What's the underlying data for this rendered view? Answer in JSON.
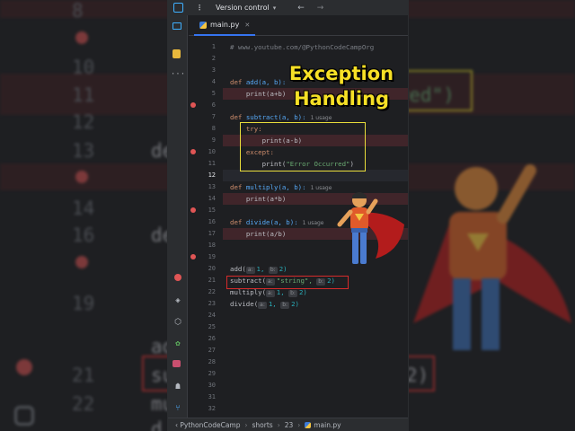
{
  "toolbar": {
    "version_control_label": "Version control"
  },
  "editor_tab": {
    "label": "main.py"
  },
  "overlay_title": {
    "line1": "Exception",
    "line2": "Handling"
  },
  "statusbar": {
    "project": "PythonCodeCamp",
    "folder": "shorts",
    "line": "23",
    "file": "main.py"
  },
  "line_numbers": [
    "1",
    "2",
    "3",
    "4",
    "5",
    "6",
    "7",
    "8",
    "9",
    "10",
    "11",
    "12",
    "13",
    "14",
    "15",
    "16",
    "17",
    "18",
    "19",
    "20",
    "21",
    "22",
    "23",
    "24",
    "25",
    "26",
    "27",
    "28",
    "29",
    "30",
    "31",
    "32"
  ],
  "code": {
    "comment": "# www.youtube.com/@PythonCodeCampOrg",
    "add_def": "add(a, b):",
    "add_body": "print(a+b)",
    "subtract_def": "subtract(a, b):",
    "subtract_usage": "1 usage",
    "try_kw": "try:",
    "try_body": "print(a-b)",
    "except_kw": "except:",
    "except_print": "print(",
    "except_str": "\"Error Occurred\"",
    "except_close": ")",
    "multiply_def": "multiply(a, b):",
    "multiply_usage": "1 usage",
    "multiply_body": "print(a*b)",
    "divide_def": "divide(a, b):",
    "divide_usage": "1 usage",
    "divide_body": "print(a/b)",
    "call_add_fn": "add(",
    "call_add_a": "a:",
    "call_add_a_val": "1,",
    "call_add_b": "b:",
    "call_add_b_val": "2)",
    "call_sub_fn": "subtract(",
    "call_sub_a": "a:",
    "call_sub_a_val": "\"string\",",
    "call_sub_b": "b:",
    "call_sub_b_val": "2)",
    "call_mul_fn": "multiply(",
    "call_mul_a": "a:",
    "call_mul_a_val": "1,",
    "call_mul_b": "b:",
    "call_mul_b_val": "2)",
    "call_div_fn": "divide(",
    "call_div_a": "a:",
    "call_div_a_val": "1,",
    "call_div_b": "b:",
    "call_div_b_val": "2)",
    "def_kw": "def"
  },
  "background_text": {
    "n8": "8",
    "n10": "10",
    "n11": "11",
    "n12": "12",
    "n13": "13",
    "n14": "14",
    "n16": "16",
    "n19": "19",
    "n21": "21",
    "n22": "22",
    "frag_rred": "rred\")",
    "frag_de1": "de",
    "frag_de2": "de",
    "frag_ad": "ad",
    "frag_su": "su",
    "frag_two": "2)",
    "frag_mu": "mu",
    "frag_d": "d"
  },
  "colors": {
    "accent": "#3574f0",
    "highlight_box": "#e8dc3a",
    "error_box": "#d52b2b",
    "title": "#f7e026",
    "breakpoint": "#e05555"
  }
}
